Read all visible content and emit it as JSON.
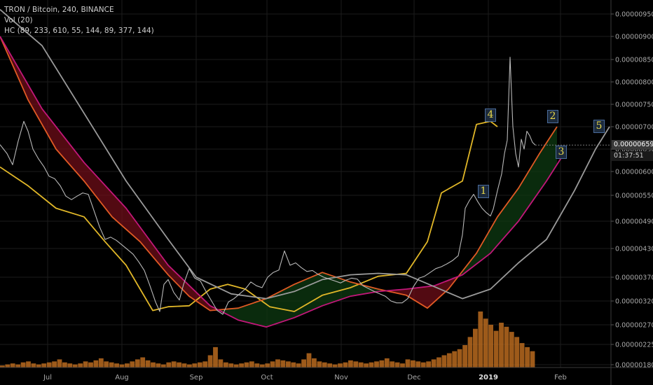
{
  "legend": {
    "symbol": "TRON / Bitcoin, 240, BINANCE",
    "vol": "Vol (20)",
    "hc": "HC (89, 233, 610, 55, 144, 89, 377, 144)"
  },
  "price_tags": {
    "last": "0.00000659",
    "countdown": "01:37:51"
  },
  "wave_labels": [
    "1",
    "2",
    "3",
    "4",
    "5"
  ],
  "colors": {
    "background": "#000000",
    "candle_line": "#b8b8b8",
    "band_yellow": "#e1b728",
    "band_orange": "#e05a24",
    "band_magenta": "#c2177a",
    "band_gray": "#9a9a9a",
    "cloud_red": "#6e0d18",
    "cloud_green": "#0d3a12",
    "volume": "#b86a1e"
  },
  "chart_data": {
    "type": "line",
    "title": "TRON / Bitcoin, 240, BINANCE",
    "x_ticks": [
      "Jul",
      "Aug",
      "Sep",
      "Oct",
      "Nov",
      "Dec",
      "2019",
      "Feb"
    ],
    "y_ticks": [
      "0.00000950",
      "0.00000900",
      "0.00000850",
      "0.00000800",
      "0.00000750",
      "0.00000700",
      "0.00000650",
      "0.00000600",
      "0.00000550",
      "0.00000490",
      "0.00000430",
      "0.00000370",
      "0.00000320",
      "0.00000270",
      "0.00000225",
      "0.00000180"
    ],
    "ylim": [
      1.8e-06,
      9.5e-06
    ],
    "price_series": {
      "name": "TRON / Bitcoin",
      "points": [
        [
          0,
          6.6e-06
        ],
        [
          10,
          6.4e-06
        ],
        [
          18,
          6.15e-06
        ],
        [
          26,
          6.68e-06
        ],
        [
          34,
          7.12e-06
        ],
        [
          40,
          6.9e-06
        ],
        [
          47,
          6.5e-06
        ],
        [
          55,
          6.28e-06
        ],
        [
          63,
          6.1e-06
        ],
        [
          70,
          5.9e-06
        ],
        [
          78,
          5.85e-06
        ],
        [
          86,
          5.7e-06
        ],
        [
          94,
          5.48e-06
        ],
        [
          102,
          5.4e-06
        ],
        [
          110,
          5.48e-06
        ],
        [
          118,
          5.55e-06
        ],
        [
          126,
          5.52e-06
        ],
        [
          134,
          5.15e-06
        ],
        [
          142,
          4.78e-06
        ],
        [
          150,
          4.5e-06
        ],
        [
          158,
          4.55e-06
        ],
        [
          166,
          4.48e-06
        ],
        [
          174,
          4.38e-06
        ],
        [
          182,
          4.28e-06
        ],
        [
          190,
          4.18e-06
        ],
        [
          198,
          4.02e-06
        ],
        [
          206,
          3.84e-06
        ],
        [
          214,
          3.52e-06
        ],
        [
          222,
          3.18e-06
        ],
        [
          228,
          2.98e-06
        ],
        [
          234,
          3.55e-06
        ],
        [
          240,
          3.65e-06
        ],
        [
          248,
          3.38e-06
        ],
        [
          256,
          3.22e-06
        ],
        [
          262,
          3.55e-06
        ],
        [
          270,
          3.88e-06
        ],
        [
          278,
          3.68e-06
        ],
        [
          286,
          3.62e-06
        ],
        [
          294,
          3.4e-06
        ],
        [
          302,
          3.2e-06
        ],
        [
          310,
          3e-06
        ],
        [
          318,
          2.92e-06
        ],
        [
          326,
          3.18e-06
        ],
        [
          334,
          3.25e-06
        ],
        [
          342,
          3.35e-06
        ],
        [
          350,
          3.45e-06
        ],
        [
          358,
          3.6e-06
        ],
        [
          366,
          3.52e-06
        ],
        [
          374,
          3.48e-06
        ],
        [
          382,
          3.7e-06
        ],
        [
          390,
          3.8e-06
        ],
        [
          398,
          3.85e-06
        ],
        [
          406,
          4.25e-06
        ],
        [
          414,
          3.95e-06
        ],
        [
          422,
          4e-06
        ],
        [
          430,
          3.9e-06
        ],
        [
          438,
          3.82e-06
        ],
        [
          446,
          3.84e-06
        ],
        [
          454,
          3.76e-06
        ],
        [
          462,
          3.7e-06
        ],
        [
          470,
          3.66e-06
        ],
        [
          478,
          3.62e-06
        ],
        [
          486,
          3.58e-06
        ],
        [
          494,
          3.64e-06
        ],
        [
          502,
          3.68e-06
        ],
        [
          510,
          3.66e-06
        ],
        [
          518,
          3.52e-06
        ],
        [
          526,
          3.46e-06
        ],
        [
          534,
          3.4e-06
        ],
        [
          542,
          3.35e-06
        ],
        [
          550,
          3.3e-06
        ],
        [
          558,
          3.2e-06
        ],
        [
          566,
          3.16e-06
        ],
        [
          574,
          3.16e-06
        ],
        [
          582,
          3.25e-06
        ],
        [
          590,
          3.5e-06
        ],
        [
          598,
          3.68e-06
        ],
        [
          606,
          3.72e-06
        ],
        [
          614,
          3.8e-06
        ],
        [
          622,
          3.88e-06
        ],
        [
          630,
          3.92e-06
        ],
        [
          638,
          3.98e-06
        ],
        [
          646,
          4.05e-06
        ],
        [
          654,
          4.15e-06
        ],
        [
          660,
          4.6e-06
        ],
        [
          664,
          5.2e-06
        ],
        [
          670,
          5.38e-06
        ],
        [
          676,
          5.52e-06
        ],
        [
          682,
          5.35e-06
        ],
        [
          688,
          5.2e-06
        ],
        [
          694,
          5.1e-06
        ],
        [
          700,
          5.02e-06
        ],
        [
          704,
          5.18e-06
        ],
        [
          710,
          5.6e-06
        ],
        [
          716,
          5.95e-06
        ],
        [
          720,
          6.4e-06
        ],
        [
          724,
          6.7e-06
        ],
        [
          728,
          8.55e-06
        ],
        [
          732,
          7e-06
        ],
        [
          736,
          6.4e-06
        ],
        [
          740,
          6.1e-06
        ],
        [
          744,
          6.72e-06
        ],
        [
          748,
          6.5e-06
        ],
        [
          752,
          6.9e-06
        ],
        [
          756,
          6.8e-06
        ],
        [
          760,
          6.65e-06
        ],
        [
          764,
          6.59e-06
        ]
      ]
    },
    "series": [
      {
        "name": "",
        "color": "yellow",
        "points": [
          [
            0,
            6.1e-06
          ],
          [
            40,
            5.7e-06
          ],
          [
            80,
            5.2e-06
          ],
          [
            120,
            5e-06
          ],
          [
            150,
            4.45e-06
          ],
          [
            180,
            3.95e-06
          ],
          [
            200,
            3.45e-06
          ],
          [
            218,
            3e-06
          ],
          [
            240,
            3.08e-06
          ],
          [
            270,
            3.1e-06
          ],
          [
            300,
            3.45e-06
          ],
          [
            325,
            3.55e-06
          ],
          [
            350,
            3.45e-06
          ],
          [
            385,
            3.08e-06
          ],
          [
            420,
            2.98e-06
          ],
          [
            460,
            3.32e-06
          ],
          [
            500,
            3.48e-06
          ],
          [
            540,
            3.72e-06
          ],
          [
            580,
            3.78e-06
          ],
          [
            610,
            4.45e-06
          ],
          [
            630,
            5.55e-06
          ],
          [
            660,
            5.8e-06
          ],
          [
            680,
            7.05e-06
          ],
          [
            700,
            7.12e-06
          ],
          [
            710,
            7e-06
          ]
        ]
      },
      {
        "name": "",
        "color": "orange",
        "points": [
          [
            0,
            9e-06
          ],
          [
            40,
            7.6e-06
          ],
          [
            80,
            6.5e-06
          ],
          [
            120,
            5.8e-06
          ],
          [
            160,
            5e-06
          ],
          [
            200,
            4.45e-06
          ],
          [
            240,
            3.75e-06
          ],
          [
            270,
            3.3e-06
          ],
          [
            300,
            3e-06
          ],
          [
            340,
            3.05e-06
          ],
          [
            380,
            3.25e-06
          ],
          [
            420,
            3.55e-06
          ],
          [
            460,
            3.8e-06
          ],
          [
            500,
            3.6e-06
          ],
          [
            540,
            3.45e-06
          ],
          [
            580,
            3.32e-06
          ],
          [
            610,
            3.05e-06
          ],
          [
            640,
            3.45e-06
          ],
          [
            680,
            4.2e-06
          ],
          [
            710,
            5e-06
          ],
          [
            740,
            5.65e-06
          ],
          [
            770,
            6.4e-06
          ],
          [
            795,
            7e-06
          ]
        ]
      },
      {
        "name": "",
        "color": "magenta",
        "points": [
          [
            0,
            9e-06
          ],
          [
            60,
            7.4e-06
          ],
          [
            120,
            6.2e-06
          ],
          [
            180,
            5.2e-06
          ],
          [
            240,
            3.95e-06
          ],
          [
            300,
            3.1e-06
          ],
          [
            340,
            2.8e-06
          ],
          [
            380,
            2.65e-06
          ],
          [
            420,
            2.85e-06
          ],
          [
            460,
            3.1e-06
          ],
          [
            500,
            3.3e-06
          ],
          [
            540,
            3.4e-06
          ],
          [
            580,
            3.45e-06
          ],
          [
            620,
            3.52e-06
          ],
          [
            660,
            3.75e-06
          ],
          [
            700,
            4.2e-06
          ],
          [
            740,
            4.9e-06
          ],
          [
            780,
            5.8e-06
          ],
          [
            805,
            6.4e-06
          ]
        ]
      },
      {
        "name": "",
        "color": "gray",
        "points": [
          [
            0,
            9.6e-06
          ],
          [
            60,
            8.8e-06
          ],
          [
            120,
            7.3e-06
          ],
          [
            180,
            5.8e-06
          ],
          [
            240,
            4.5e-06
          ],
          [
            280,
            3.7e-06
          ],
          [
            330,
            3.35e-06
          ],
          [
            380,
            3.25e-06
          ],
          [
            420,
            3.4e-06
          ],
          [
            460,
            3.65e-06
          ],
          [
            500,
            3.75e-06
          ],
          [
            540,
            3.78e-06
          ],
          [
            580,
            3.75e-06
          ],
          [
            620,
            3.5e-06
          ],
          [
            660,
            3.25e-06
          ],
          [
            700,
            3.45e-06
          ],
          [
            740,
            4e-06
          ],
          [
            780,
            4.5e-06
          ],
          [
            820,
            5.6e-06
          ],
          [
            850,
            6.5e-06
          ],
          [
            870,
            7e-06
          ]
        ]
      }
    ],
    "volume": [
      2,
      3,
      4,
      3,
      5,
      6,
      4,
      3,
      4,
      5,
      6,
      8,
      5,
      4,
      3,
      4,
      6,
      5,
      7,
      9,
      6,
      5,
      4,
      3,
      4,
      6,
      8,
      10,
      7,
      5,
      4,
      3,
      5,
      6,
      5,
      4,
      3,
      4,
      5,
      6,
      12,
      20,
      8,
      5,
      4,
      3,
      4,
      5,
      6,
      4,
      3,
      4,
      6,
      8,
      7,
      6,
      5,
      4,
      8,
      14,
      9,
      6,
      5,
      4,
      3,
      4,
      5,
      7,
      6,
      5,
      4,
      5,
      6,
      7,
      9,
      6,
      5,
      4,
      8,
      7,
      6,
      5,
      6,
      8,
      10,
      12,
      14,
      16,
      18,
      22,
      30,
      38,
      55,
      48,
      42,
      36,
      44,
      40,
      35,
      30,
      24,
      20,
      16
    ]
  }
}
